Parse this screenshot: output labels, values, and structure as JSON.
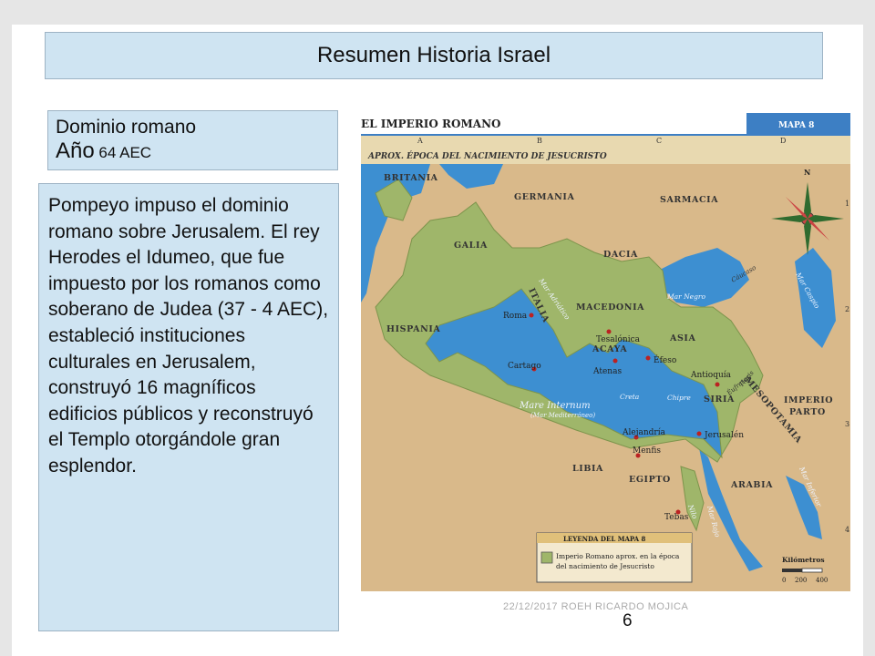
{
  "slide": {
    "title": "Resumen Historia Israel",
    "subtitle_line1": "Dominio romano",
    "subtitle_line2_big": "Año",
    "subtitle_line2_small": " 64 AEC",
    "body": "Pompeyo impuso el dominio romano  sobre Jerusalem. El rey Herodes el Idumeo, que fue impuesto por los romanos como soberano de Judea (37 - 4 AEC), estableció instituciones culturales en Jerusalem, construyó 16 magníficos edificios públicos y reconstruyó el Templo otorgándole gran esplendor.",
    "footer": "22/12/2017    ROEH RICARDO MOJICA",
    "page_number": "6"
  },
  "map": {
    "title": "EL IMPERIO ROMANO",
    "map_label": "MAPA 8",
    "subtitle": "APROX. ÉPOCA DEL NACIMIENTO DE JESUCRISTO",
    "grid_columns": [
      "A",
      "B",
      "C",
      "D"
    ],
    "grid_rows": [
      "1",
      "2",
      "3",
      "4"
    ],
    "compass_north": "N",
    "regions": {
      "britania": "BRITANIA",
      "germania": "GERMANIA",
      "sarmacia": "SARMACIA",
      "galia": "GALIA",
      "dacia": "DACIA",
      "italia": "ITALIA",
      "macedonia": "MACEDONIA",
      "hispania": "HISPANIA",
      "acaya": "ACAYA",
      "asia": "ASIA",
      "siria": "SIRIA",
      "mesopotamia": "MESOPOTAMIA",
      "imperio_parto_1": "IMPERIO",
      "imperio_parto_2": "PARTO",
      "libia": "LIBIA",
      "egipto": "EGIPTO",
      "arabia": "ARABIA"
    },
    "cities": {
      "roma": "Roma",
      "tesalonica": "Tesalónica",
      "efeso": "Éfeso",
      "atenas": "Atenas",
      "cartago": "Cartago",
      "antioquia": "Antioquía",
      "jerusalen": "Jerusalén",
      "alejandria": "Alejandría",
      "menfis": "Menfis",
      "tebas": "Tebas"
    },
    "water": {
      "mar_adriatico": "Mar Adriático",
      "mar_negro": "Mar Negro",
      "caucaso": "Cáucaso",
      "mar_caspio": "Mar Caspio",
      "mare_internum": "Mare Internum",
      "mar_mediterraneo": "(Mar Mediterráneo)",
      "creta": "Creta",
      "chipre": "Chipre",
      "tigris": "Tigris",
      "eufrates": "Éufrates",
      "nilo": "Nilo",
      "mar_rojo": "Mar Rojo",
      "mar_inferior": "Mar Inferior"
    },
    "legend_title": "LEYENDA DEL MAPA 8",
    "legend_text_1": "Imperio Romano aprox. en la época",
    "legend_text_2": "del nacimiento de Jesucristo",
    "scale_title": "Kilómetros",
    "scale_ticks": [
      "0",
      "200",
      "400"
    ],
    "colors": {
      "sea": "#3d8fd1",
      "empire": "#9fb66a",
      "land": "#d9b98a",
      "header": "#e8d9b0"
    }
  }
}
